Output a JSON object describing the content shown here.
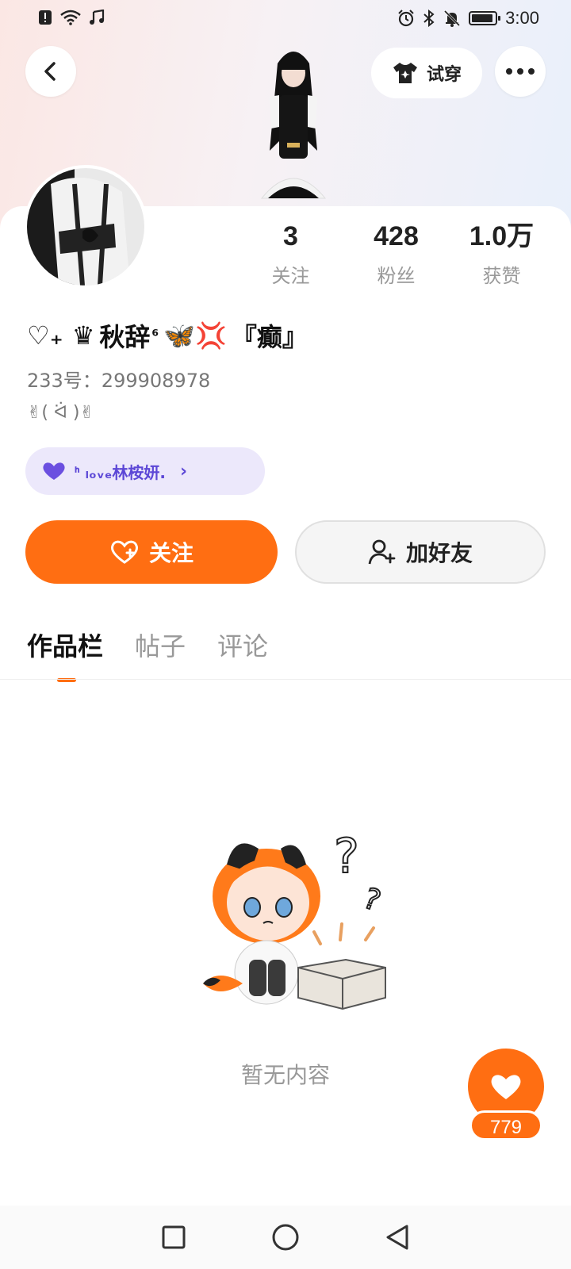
{
  "status_bar": {
    "time": "3:00",
    "left_icons": [
      "alert-icon",
      "wifi-icon",
      "music-icon"
    ],
    "right_icons": [
      "alarm-icon",
      "bluetooth-icon",
      "mute-bell-icon",
      "battery-icon"
    ]
  },
  "header": {
    "tryon_label": "试穿"
  },
  "stats": [
    {
      "value": "3",
      "label": "关注"
    },
    {
      "value": "428",
      "label": "粉丝"
    },
    {
      "value": "1.0万",
      "label": "获赞"
    }
  ],
  "profile": {
    "name_prefix": "♡₊ ♛",
    "name_main": "秋辞",
    "name_sup": "⁶",
    "name_emojis": "🦋💢",
    "name_suffix": "『癫』",
    "uid": "233号：299908978",
    "signature": "✌( ᐛ )✌",
    "cp_label": "ᑋ ₗₒᵥₑ林桉妍.",
    "cp_chevron": "›"
  },
  "actions": {
    "follow_label": "关注",
    "add_friend_label": "加好友"
  },
  "tabs": [
    {
      "label": "作品栏",
      "active": true
    },
    {
      "label": "帖子",
      "active": false
    },
    {
      "label": "评论",
      "active": false
    }
  ],
  "empty_state": {
    "text": "暂无内容"
  },
  "fab": {
    "count": "779"
  },
  "colors": {
    "accent": "#ff6e12",
    "cp_text": "#5c47d6",
    "cp_bg": "#ece8fb"
  }
}
